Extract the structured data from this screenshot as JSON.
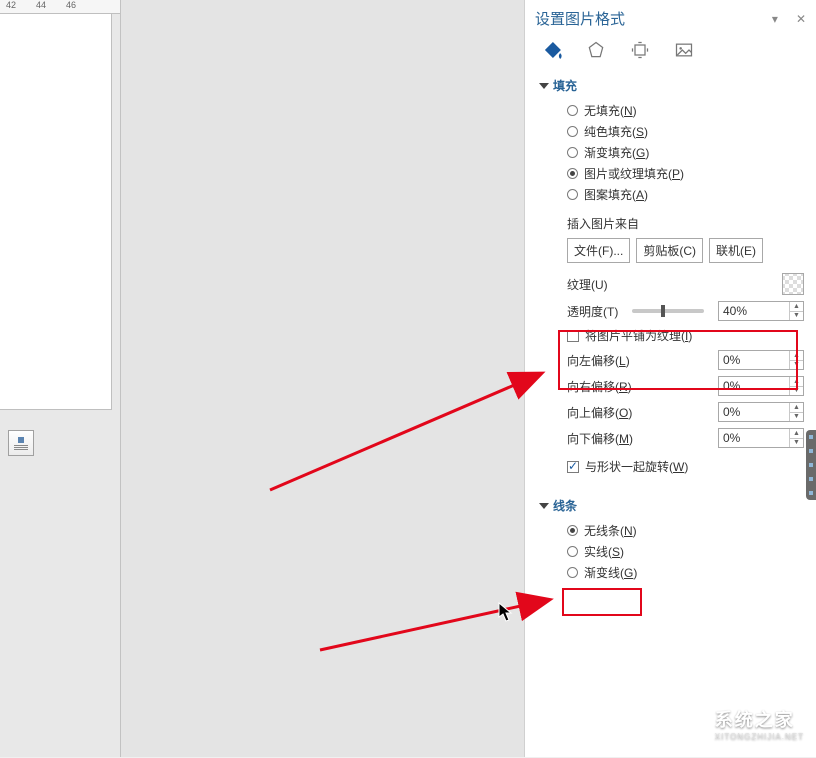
{
  "ruler": {
    "t1": "42",
    "t2": "44",
    "t3": "46"
  },
  "panel": {
    "title": "设置图片格式",
    "dropdown_glyph": "▾",
    "close_glyph": "✕",
    "icons": [
      "fill-icon",
      "effects-icon",
      "size-icon",
      "picture-icon"
    ]
  },
  "fill": {
    "section": "填充",
    "options": {
      "no_fill": {
        "label": "无填充(",
        "key": "N",
        "suffix": ")",
        "checked": false
      },
      "solid": {
        "label": "纯色填充(",
        "key": "S",
        "suffix": ")",
        "checked": false
      },
      "gradient": {
        "label": "渐变填充(",
        "key": "G",
        "suffix": ")",
        "checked": false
      },
      "picture": {
        "label": "图片或纹理填充(",
        "key": "P",
        "suffix": ")",
        "checked": true
      },
      "pattern": {
        "label": "图案填充(",
        "key": "A",
        "suffix": ")",
        "checked": false
      }
    },
    "insert_from": "插入图片来自",
    "buttons": {
      "file": "文件(F)...",
      "clipboard": "剪贴板(C)",
      "online": "联机(E)"
    },
    "texture_label": "纹理(U)",
    "transparency": {
      "label": "透明度(T)",
      "value": "40%",
      "slider_pct": 40
    },
    "tile_as_texture": {
      "label": "将图片平铺为纹理(",
      "key": "I",
      "suffix": ")",
      "checked": false
    },
    "offset_left": {
      "label": "向左偏移(",
      "key": "L",
      "suffix": ")",
      "value": "0%"
    },
    "offset_right": {
      "label": "向右偏移(",
      "key": "R",
      "suffix": ")",
      "value": "0%"
    },
    "offset_up": {
      "label": "向上偏移(",
      "key": "O",
      "suffix": ")",
      "value": "0%"
    },
    "offset_down": {
      "label": "向下偏移(",
      "key": "M",
      "suffix": ")",
      "value": "0%"
    },
    "rotate_with_shape": {
      "label": "与形状一起旋转(",
      "key": "W",
      "suffix": ")",
      "checked": true
    }
  },
  "line": {
    "section": "线条",
    "options": {
      "none": {
        "label": "无线条(",
        "key": "N",
        "suffix": ")",
        "checked": true
      },
      "solid": {
        "label": "实线(",
        "key": "S",
        "suffix": ")",
        "checked": false
      },
      "gradient": {
        "label": "渐变线(",
        "key": "G",
        "suffix": ")",
        "checked": false
      }
    }
  },
  "watermark": {
    "cn": "系统之家",
    "en": "XITONGZHIJIA.NET"
  }
}
